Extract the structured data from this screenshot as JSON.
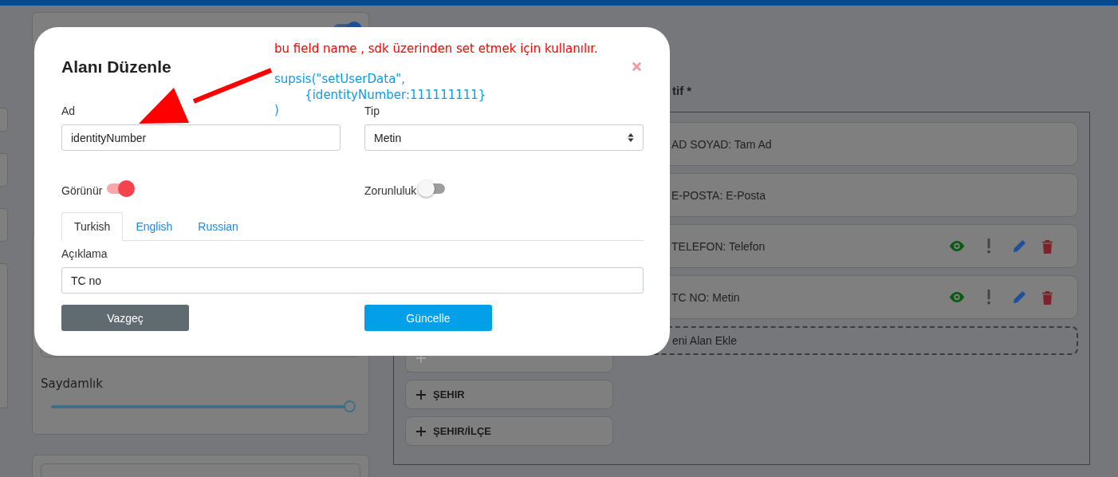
{
  "background": {
    "left_panel": {
      "top_toggle": {
        "on": true
      },
      "opacity": {
        "label": "Saydamlık",
        "level": 1
      }
    },
    "right_panel": {
      "heading": "tif *",
      "field_buttons": [
        {
          "disabled": true
        },
        {
          "label": "ŞEHIR",
          "disabled": false
        },
        {
          "label": "ŞEHIR/İLÇE",
          "disabled": false
        }
      ],
      "fields": [
        {
          "label": "AD SOYAD: Tam Ad",
          "kind": "fixed"
        },
        {
          "label": "E-POSTA: E-Posta",
          "kind": "fixed"
        },
        {
          "label": "TELEFON: Telefon",
          "kind": "custom"
        },
        {
          "label": "TC NO: Metin",
          "kind": "custom"
        }
      ],
      "add_field": "eni Alan Ekle"
    }
  },
  "modal": {
    "title": "Alanı Düzenle",
    "note": "bu field name , sdk üzerinden set etmek için kullanılır.",
    "code_lines": [
      "supsis(\"setUserData\",",
      "        {identityNumber:111111111}",
      ")"
    ],
    "name_label": "Ad",
    "name_value": "identityNumber",
    "type_label": "Tip",
    "type_value": "Metin",
    "visible": {
      "label": "Görünür",
      "on": true
    },
    "required": {
      "label": "Zorunluluk",
      "on": false
    },
    "tabs": [
      {
        "label": "Turkish",
        "selected": true
      },
      {
        "label": "English",
        "selected": false
      },
      {
        "label": "Russian",
        "selected": false
      }
    ],
    "description_label": "Açıklama",
    "description_value": "TC no",
    "cancel": "Vazgeç",
    "update": "Güncelle"
  }
}
